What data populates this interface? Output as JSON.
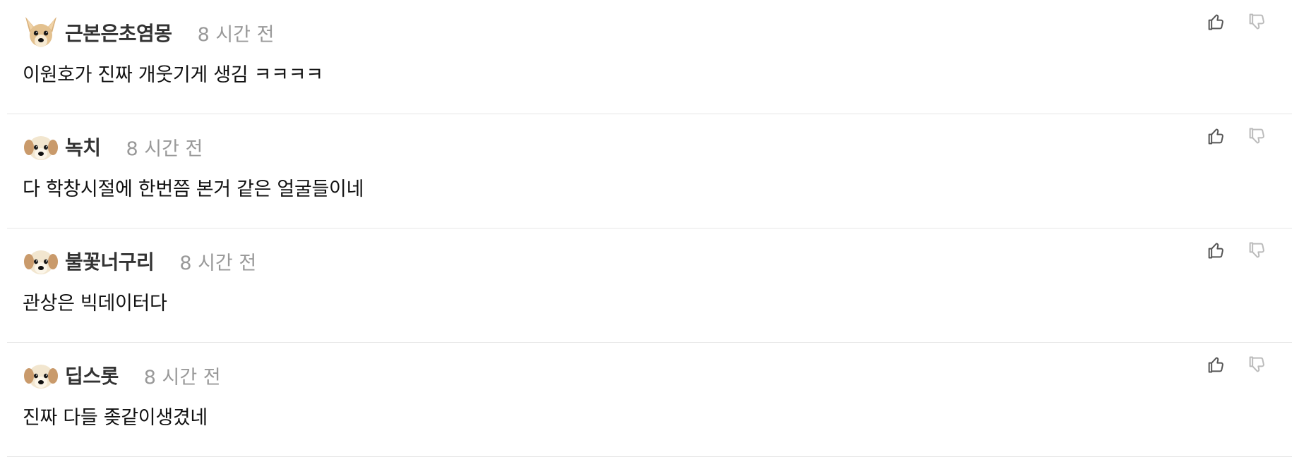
{
  "comments": [
    {
      "nickname": "근본은초염몽",
      "timestamp": "8 시간 전",
      "body": "이원호가 진짜 개웃기게 생김 ㅋㅋㅋㅋ",
      "avatar": "chihuahua"
    },
    {
      "nickname": "녹치",
      "timestamp": "8 시간 전",
      "body": "다 학창시절에 한번쯤 본거 같은 얼굴들이네",
      "avatar": "puppy"
    },
    {
      "nickname": "불꽃너구리",
      "timestamp": "8 시간 전",
      "body": "관상은 빅데이터다",
      "avatar": "puppy"
    },
    {
      "nickname": "딥스롯",
      "timestamp": "8 시간 전",
      "body": "진짜 다들 좆같이생겼네",
      "avatar": "puppy"
    }
  ],
  "icons": {
    "like": "thumbs-up-icon",
    "dislike": "thumbs-down-icon"
  },
  "colors": {
    "nickname": "#333333",
    "timestamp": "#999999",
    "divider": "#e6e6e6",
    "like_icon": "#555555",
    "dislike_icon": "#bbbbbb"
  }
}
